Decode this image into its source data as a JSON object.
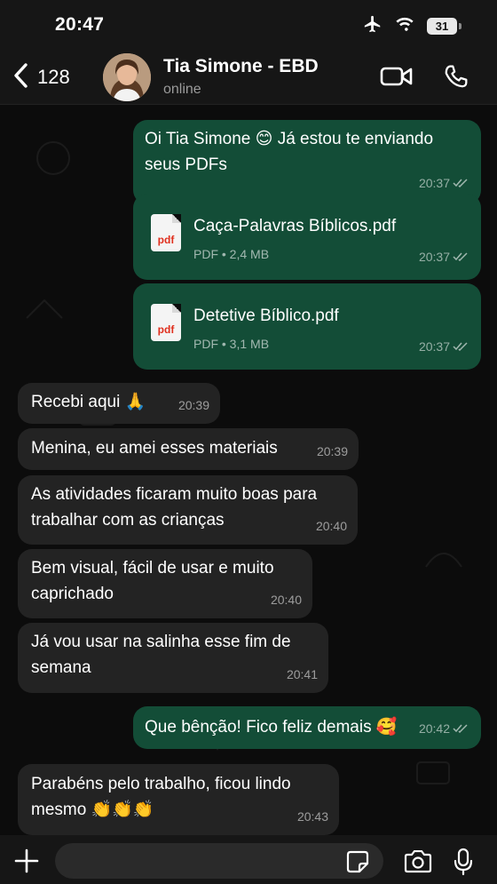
{
  "status_bar": {
    "time": "20:47",
    "battery": "31"
  },
  "header": {
    "back_count": "128",
    "name": "Tia Simone - EBD",
    "status": "online"
  },
  "messages": [
    {
      "dir": "out",
      "lines": [
        "Oi Tia Simone 😊 Já estou te enviando",
        "seus PDFs"
      ],
      "time": "20:37"
    },
    {
      "dir": "out",
      "file": "Caça-Palavras Bíblicos.pdf",
      "file_info": "PDF • 2,4 MB",
      "time": "20:37"
    },
    {
      "dir": "out",
      "file": "Detetive Bíblico.pdf",
      "file_info": "PDF • 3,1 MB",
      "time": "20:37"
    },
    {
      "dir": "in",
      "lines": [
        "Recebi aqui 🙏"
      ],
      "time": "20:39"
    },
    {
      "dir": "in",
      "lines": [
        "Menina, eu amei esses materiais"
      ],
      "time": "20:39"
    },
    {
      "dir": "in",
      "lines": [
        "As atividades ficaram muito boas para",
        "trabalhar com as crianças"
      ],
      "time": "20:40"
    },
    {
      "dir": "in",
      "lines": [
        "Bem visual, fácil de usar e muito",
        "caprichado"
      ],
      "time": "20:40"
    },
    {
      "dir": "in",
      "lines": [
        "Já vou usar na salinha esse fim de",
        "semana"
      ],
      "time": "20:41"
    },
    {
      "dir": "out",
      "lines": [
        "Que bênção! Fico feliz demais 🥰"
      ],
      "time": "20:42"
    },
    {
      "dir": "in",
      "lines": [
        "Parabéns pelo trabalho, ficou lindo",
        "mesmo 👏👏👏"
      ],
      "time": "20:43"
    }
  ],
  "icons": {
    "status": [
      "airplane-icon",
      "wifi-icon",
      "battery-icon"
    ],
    "header": [
      "chevron-left-icon",
      "video-camera-icon",
      "phone-icon"
    ],
    "composer": [
      "plus-icon",
      "sticker-icon",
      "camera-icon",
      "microphone-icon"
    ]
  },
  "colors": {
    "outgoing": "#134d37",
    "incoming": "#232323",
    "background": "#0c0c0c",
    "bar": "#161616"
  }
}
